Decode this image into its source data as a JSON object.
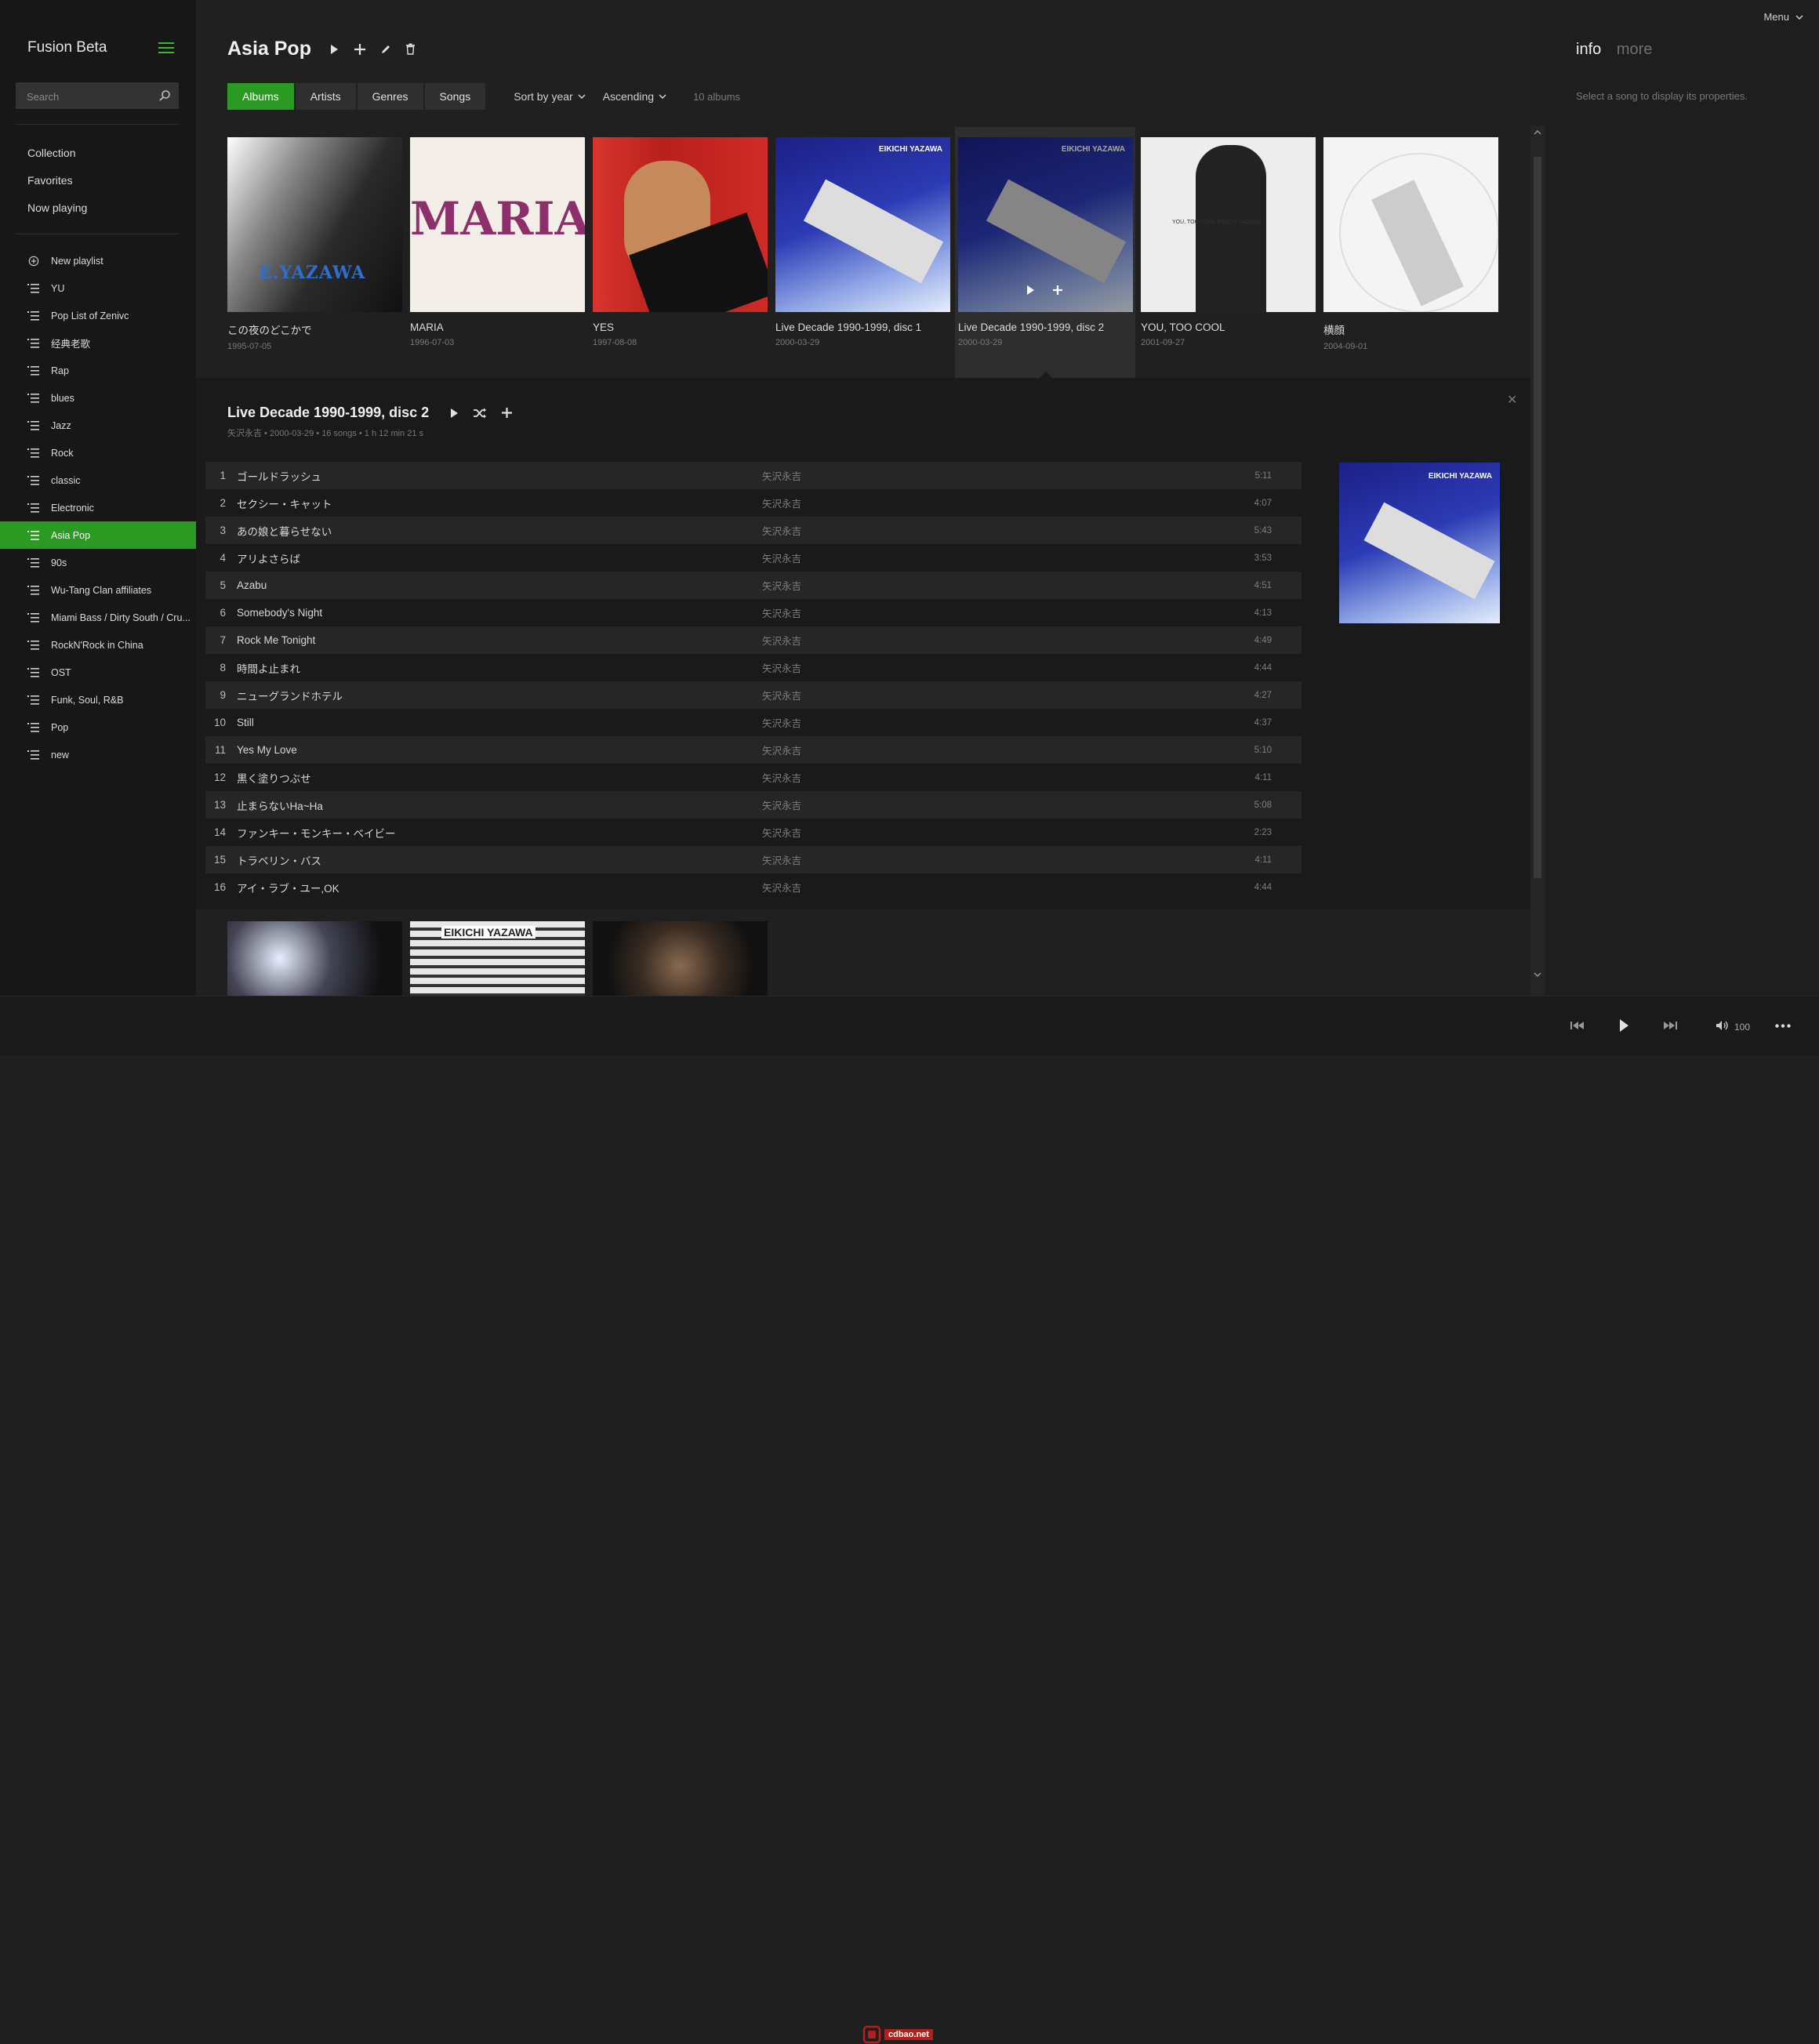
{
  "app": {
    "title": "Fusion Beta",
    "menu_label": "Menu"
  },
  "search": {
    "placeholder": "Search"
  },
  "nav": [
    "Collection",
    "Favorites",
    "Now playing"
  ],
  "playlists": {
    "new_label": "New playlist",
    "items": [
      "YU",
      "Pop List of Zenivc",
      "经典老歌",
      "Rap",
      "blues",
      "Jazz",
      "Rock",
      "classic",
      "Electronic",
      "Asia Pop",
      "90s",
      "Wu-Tang Clan affiliates",
      "Miami Bass / Dirty South / Cru...",
      "RockN'Rock in China",
      "OST",
      "Funk, Soul, R&B",
      "Pop",
      "new"
    ],
    "active": "Asia Pop"
  },
  "page": {
    "title": "Asia Pop",
    "tabs": [
      "Albums",
      "Artists",
      "Genres",
      "Songs"
    ],
    "active_tab": "Albums",
    "sort": "Sort by year",
    "order": "Ascending",
    "album_count": "10 albums"
  },
  "albums": [
    {
      "title": "この夜のどこかで",
      "date": "1995-07-05",
      "cover_text": "E.YAZAWA"
    },
    {
      "title": "MARIA",
      "date": "1996-07-03",
      "cover_text": "MARIA"
    },
    {
      "title": "YES",
      "date": "1997-08-08",
      "cover_text": ""
    },
    {
      "title": "Live Decade 1990-1999, disc 1",
      "date": "2000-03-29",
      "cover_text": "EIKICHI YAZAWA"
    },
    {
      "title": "Live Decade 1990-1999, disc 2",
      "date": "2000-03-29",
      "cover_text": "EIKICHI YAZAWA"
    },
    {
      "title": "YOU, TOO COOL",
      "date": "2001-09-27",
      "cover_text": "YOU, TOO COOL EIKICHI YAZAWA"
    },
    {
      "title": "横顔",
      "date": "2004-09-01",
      "cover_text": ""
    }
  ],
  "detail": {
    "title": "Live Decade 1990-1999, disc 2",
    "subtitle": "矢沢永吉 • 2000-03-29 • 16 songs • 1 h 12 min 21 s",
    "cover_text": "EIKICHI YAZAWA",
    "tracks": [
      {
        "n": "1",
        "title": "ゴールドラッシュ",
        "artist": "矢沢永吉",
        "dur": "5:11"
      },
      {
        "n": "2",
        "title": "セクシー・キャット",
        "artist": "矢沢永吉",
        "dur": "4:07"
      },
      {
        "n": "3",
        "title": "あの娘と暮らせない",
        "artist": "矢沢永吉",
        "dur": "5:43"
      },
      {
        "n": "4",
        "title": "アリよさらば",
        "artist": "矢沢永吉",
        "dur": "3:53"
      },
      {
        "n": "5",
        "title": "Azabu",
        "artist": "矢沢永吉",
        "dur": "4:51"
      },
      {
        "n": "6",
        "title": "Somebody's Night",
        "artist": "矢沢永吉",
        "dur": "4:13"
      },
      {
        "n": "7",
        "title": "Rock Me Tonight",
        "artist": "矢沢永吉",
        "dur": "4:49"
      },
      {
        "n": "8",
        "title": "時間よ止まれ",
        "artist": "矢沢永吉",
        "dur": "4:44"
      },
      {
        "n": "9",
        "title": "ニューグランドホテル",
        "artist": "矢沢永吉",
        "dur": "4:27"
      },
      {
        "n": "10",
        "title": "Still",
        "artist": "矢沢永吉",
        "dur": "4:37"
      },
      {
        "n": "11",
        "title": "Yes My Love",
        "artist": "矢沢永吉",
        "dur": "5:10"
      },
      {
        "n": "12",
        "title": "黒く塗りつぶせ",
        "artist": "矢沢永吉",
        "dur": "4:11"
      },
      {
        "n": "13",
        "title": "止まらないHa~Ha",
        "artist": "矢沢永吉",
        "dur": "5:08"
      },
      {
        "n": "14",
        "title": "ファンキー・モンキー・ベイビー",
        "artist": "矢沢永吉",
        "dur": "2:23"
      },
      {
        "n": "15",
        "title": "トラベリン・バス",
        "artist": "矢沢永吉",
        "dur": "4:11"
      },
      {
        "n": "16",
        "title": "アイ・ラブ・ユー,OK",
        "artist": "矢沢永吉",
        "dur": "4:44"
      }
    ]
  },
  "more_albums": [
    {
      "cover_text": ""
    },
    {
      "cover_text": "EIKICHI YAZAWA"
    },
    {
      "cover_text": ""
    }
  ],
  "info": {
    "tabs": [
      "info",
      "more"
    ],
    "message": "Select a song to display its properties."
  },
  "player": {
    "volume": "100"
  },
  "watermark": {
    "text": "cdbao.net"
  },
  "colors": {
    "accent": "#2b9a22",
    "background": "#1f1f1f",
    "sidebar": "#171717"
  }
}
